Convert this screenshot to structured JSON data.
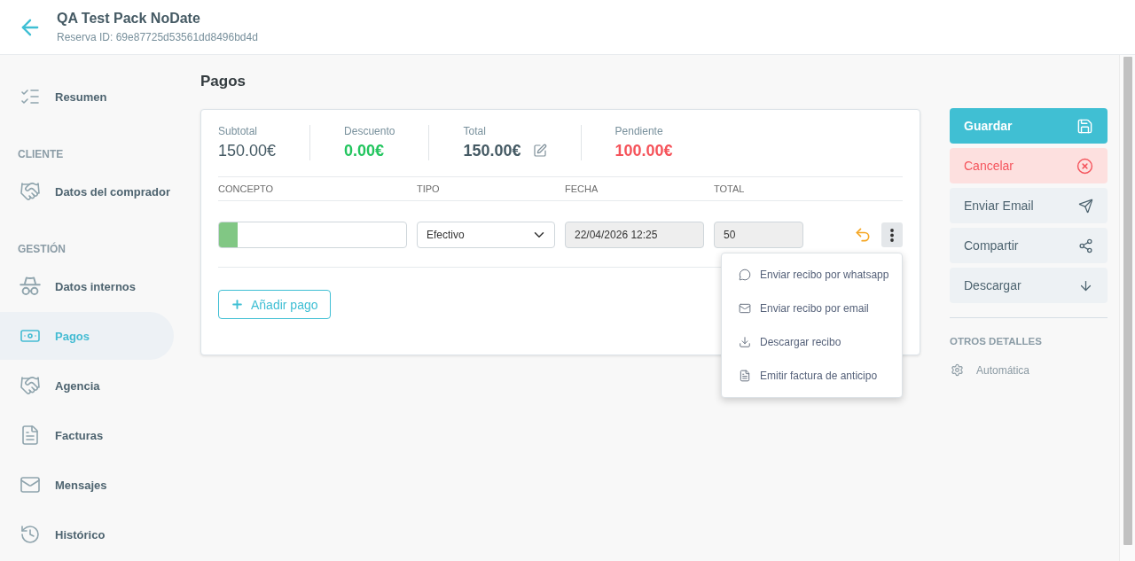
{
  "header": {
    "title": "QA Test Pack NoDate",
    "subtitle": "Reserva ID: 69e87725d53561dd8496bd4d"
  },
  "sidebar": {
    "items": [
      {
        "label": "Resumen",
        "selected": false
      }
    ],
    "sections": [
      {
        "heading": "CLIENTE",
        "items": [
          {
            "label": "Datos del comprador",
            "selected": false
          }
        ]
      },
      {
        "heading": "GESTIÓN",
        "items": [
          {
            "label": "Datos internos",
            "selected": false
          },
          {
            "label": "Pagos",
            "selected": true
          },
          {
            "label": "Agencia",
            "selected": false
          },
          {
            "label": "Facturas",
            "selected": false
          },
          {
            "label": "Mensajes",
            "selected": false
          },
          {
            "label": "Histórico",
            "selected": false
          }
        ]
      }
    ]
  },
  "page_title": "Pagos",
  "summary": [
    {
      "kind": "plain",
      "label": "Subtotal",
      "value": "150.00€"
    },
    {
      "kind": "positive",
      "label": "Descuento",
      "value": "0.00€"
    },
    {
      "kind": "total",
      "label": "Total",
      "value": "150.00€"
    },
    {
      "kind": "negative",
      "label": "Pendiente",
      "value": "100.00€"
    }
  ],
  "payments": {
    "columns": [
      "CONCEPTO",
      "TIPO",
      "FECHA",
      "TOTAL"
    ],
    "rows": [
      {
        "color": "#81c784",
        "type": "Efectivo",
        "date": "22/04/2026 12:25",
        "total": "50",
        "menu_open": true
      }
    ]
  },
  "row_menu": {
    "items": [
      {
        "label": "Enviar recibo por whatsapp"
      },
      {
        "label": "Enviar recibo por email"
      },
      {
        "label": "Descargar recibo"
      },
      {
        "label": "Emitir factura de anticipo"
      }
    ]
  },
  "add_button": "Añadir pago",
  "actions": [
    {
      "kind": "primary",
      "label": "Guardar"
    },
    {
      "kind": "danger",
      "label": "Cancelar"
    },
    {
      "kind": "default",
      "label": "Enviar Email"
    },
    {
      "kind": "default",
      "label": "Compartir"
    },
    {
      "kind": "default",
      "label": "Descargar"
    }
  ],
  "other_details": {
    "heading": "OTROS DETALLES",
    "items": [
      {
        "label": "Automática"
      }
    ]
  }
}
